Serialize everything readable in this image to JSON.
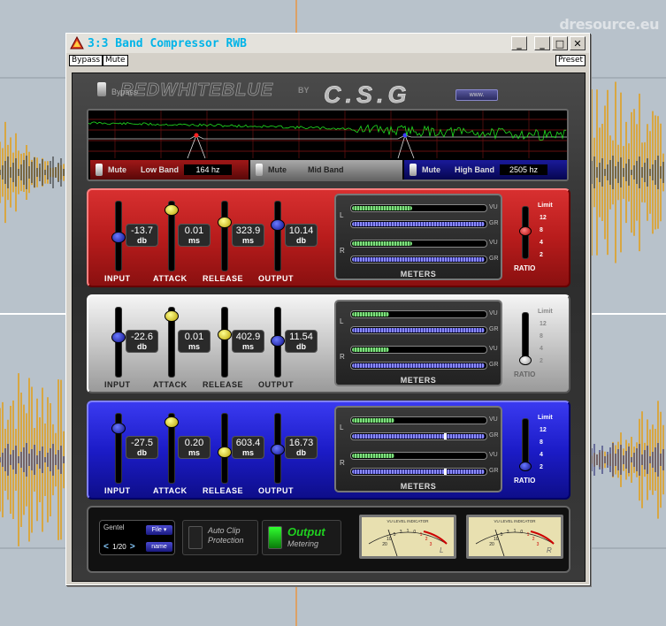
{
  "watermark": "dresource.eu",
  "window": {
    "title": "3:3 Band Compressor RWB",
    "controls": {
      "minimize": "_",
      "restore": "□",
      "close": "✕",
      "extra": "_"
    }
  },
  "menubar": {
    "bypass": "Bypass",
    "mute": "Mute",
    "preset": "Preset"
  },
  "header": {
    "bypass_label": "Bypass",
    "logo_text": "REDWHITEBLUE",
    "logo_by": "BY",
    "logo_brand": "C.S.G",
    "www_label": "www."
  },
  "spectrum": {
    "low": {
      "mute": "Mute",
      "name": "Low Band",
      "freq": "164 hz"
    },
    "mid": {
      "mute": "Mute",
      "name": "Mid Band"
    },
    "high": {
      "mute": "Mute",
      "name": "High Band",
      "freq": "2505 hz"
    }
  },
  "labels": {
    "input": "INPUT",
    "attack": "ATTACK",
    "release": "RELEASE",
    "output": "OUTPUT",
    "meters": "METERS",
    "ratio": "RATIO",
    "limit": "Limit",
    "vu": "VU",
    "gr": "GR",
    "left": "L",
    "right": "R",
    "db": "db",
    "ms": "ms",
    "ratio_marks": [
      "12",
      "8",
      "4",
      "2"
    ]
  },
  "bands": [
    {
      "color": "red",
      "input": "-13.7",
      "attack": "0.01",
      "release": "323.9",
      "output": "10.14",
      "levels": {
        "input": 0.5,
        "attack": 0.95,
        "release": 0.75,
        "output": 0.7,
        "ratio": 0.55
      },
      "meters": {
        "vu_l": 0.45,
        "gr_l": 0.0,
        "vu_r": 0.45,
        "gr_r": 0.0
      }
    },
    {
      "color": "silver",
      "input": "-22.6",
      "attack": "0.01",
      "release": "402.9",
      "output": "11.54",
      "levels": {
        "input": 0.6,
        "attack": 0.95,
        "release": 0.65,
        "output": 0.55,
        "ratio": 0.0
      },
      "meters": {
        "vu_l": 0.28,
        "gr_l": 0.0,
        "vu_r": 0.28,
        "gr_r": 0.0
      }
    },
    {
      "color": "blue",
      "input": "-27.5",
      "attack": "0.20",
      "release": "603.4",
      "output": "16.73",
      "levels": {
        "input": 0.85,
        "attack": 0.95,
        "release": 0.45,
        "output": 0.5,
        "ratio": 0.0
      },
      "meters": {
        "vu_l": 0.32,
        "gr_l": 0.7,
        "vu_r": 0.32,
        "gr_r": 0.7
      }
    }
  ],
  "preset": {
    "name": "Gentel",
    "file": "File ▾",
    "prev": "<",
    "count": "1/20",
    "next": ">",
    "name_btn": "name"
  },
  "options": {
    "auto_clip": {
      "line1": "Auto Clip",
      "line2": "Protection"
    },
    "output_metering": {
      "line1": "Output",
      "line2": "Metering"
    }
  },
  "vu_meters": [
    {
      "title": "VU LEVEL INDICATOR",
      "channel": "L",
      "scale": [
        "20",
        "10",
        "5",
        "3",
        "1",
        "0",
        "1",
        "2",
        "3"
      ]
    },
    {
      "title": "VU LEVEL INDICATOR",
      "channel": "R",
      "scale": [
        "20",
        "10",
        "5",
        "3",
        "1",
        "0",
        "1",
        "2",
        "3"
      ]
    }
  ],
  "colors": {
    "title": "#00b4e8",
    "band_red": "#c82424",
    "band_silver": "#cccccc",
    "band_blue": "#2424d8",
    "vu_fill": "#7ee07e",
    "gr_fill": "#8a8aff"
  }
}
